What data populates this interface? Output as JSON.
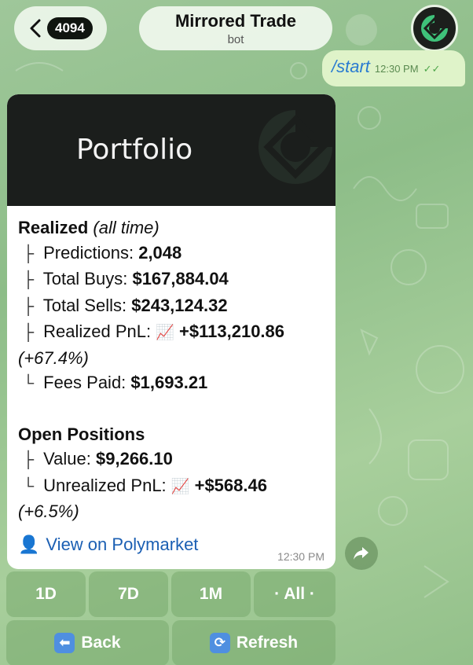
{
  "header": {
    "unread_count": "4094",
    "chat_title": "Mirrored Trade",
    "chat_subtitle": "bot"
  },
  "outgoing": {
    "text": "/start",
    "time": "12:30 PM"
  },
  "card": {
    "banner_title": "Portfolio",
    "realized": {
      "heading": "Realized",
      "heading_note": "(all time)",
      "predictions_label": "Predictions:",
      "predictions_value": "2,048",
      "total_buys_label": "Total Buys:",
      "total_buys_value": "$167,884.04",
      "total_sells_label": "Total Sells:",
      "total_sells_value": "$243,124.32",
      "pnl_label": "Realized PnL:",
      "pnl_value": "+$113,210.86",
      "pnl_pct": "(+67.4%)",
      "fees_label": "Fees Paid:",
      "fees_value": "$1,693.21"
    },
    "open": {
      "heading": "Open Positions",
      "value_label": "Value:",
      "value_value": "$9,266.10",
      "unrealized_label": "Unrealized PnL:",
      "unrealized_value": "+$568.46",
      "unrealized_pct": "(+6.5%)"
    },
    "link_text": "View on Polymarket",
    "time": "12:30 PM"
  },
  "keyboard": {
    "row1": [
      "1D",
      "7D",
      "1M",
      "· All ·"
    ],
    "back_label": "Back",
    "refresh_label": "Refresh"
  },
  "icons": {
    "tree_branch": "├",
    "tree_end": "└",
    "chart_emoji": "📈",
    "back_emoji": "⬅️",
    "refresh_emoji": "🔄",
    "person_emoji": "👤"
  }
}
